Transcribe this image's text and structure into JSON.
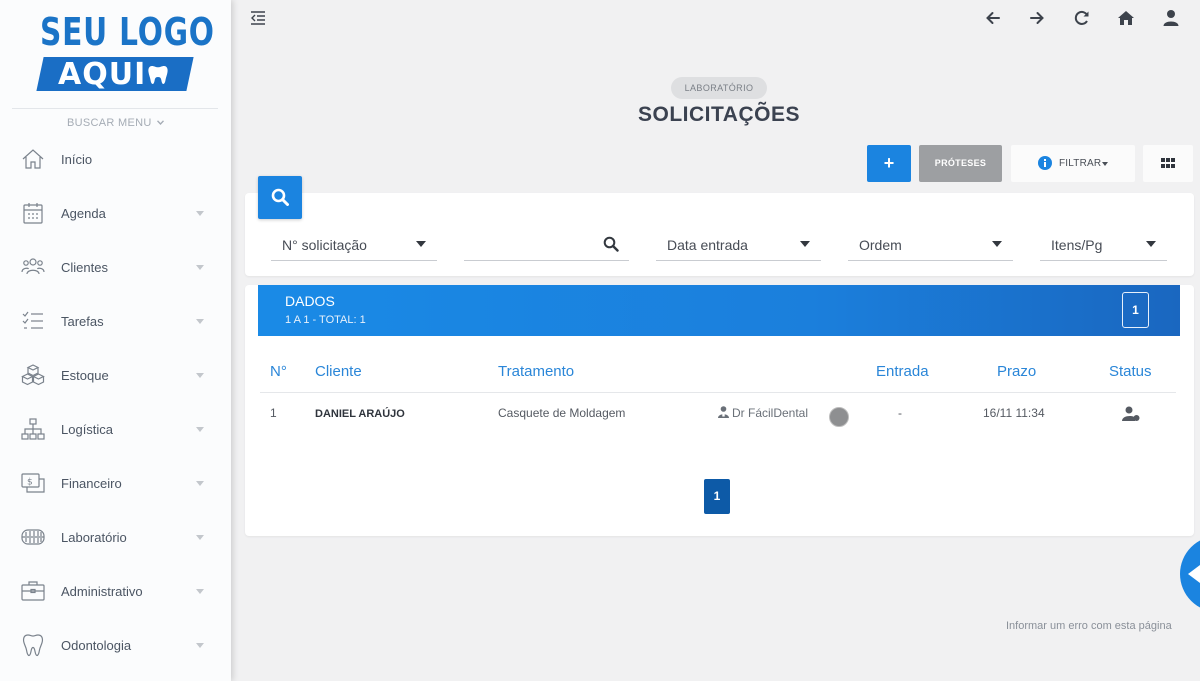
{
  "logo": {
    "line1": "SEU LOGO",
    "line2": "AQUI"
  },
  "sidebar": {
    "search_menu": "BUSCAR MENU",
    "items": [
      {
        "label": "Início",
        "icon": "home-icon",
        "has_caret": false
      },
      {
        "label": "Agenda",
        "icon": "calendar-icon",
        "has_caret": true
      },
      {
        "label": "Clientes",
        "icon": "users-icon",
        "has_caret": true
      },
      {
        "label": "Tarefas",
        "icon": "tasks-icon",
        "has_caret": true
      },
      {
        "label": "Estoque",
        "icon": "boxes-icon",
        "has_caret": true
      },
      {
        "label": "Logística",
        "icon": "hierarchy-icon",
        "has_caret": true
      },
      {
        "label": "Financeiro",
        "icon": "money-icon",
        "has_caret": true
      },
      {
        "label": "Laboratório",
        "icon": "dentures-icon",
        "has_caret": true
      },
      {
        "label": "Administrativo",
        "icon": "briefcase-icon",
        "has_caret": true
      },
      {
        "label": "Odontologia",
        "icon": "tooth-icon",
        "has_caret": true
      }
    ]
  },
  "header": {
    "breadcrumb": "LABORATÓRIO",
    "title": "SOLICITAÇÕES"
  },
  "toolbar": {
    "add_label": "+",
    "proteses_label": "PRÓTESES",
    "filter_label": "FILTRAR"
  },
  "filters": {
    "numero": "N° solicitação",
    "search_value": "",
    "data_entrada": "Data entrada",
    "ordem": "Ordem",
    "itens_pg": "Itens/Pg"
  },
  "data_panel": {
    "title": "DADOS",
    "subtitle": "1 A 1 - TOTAL: 1",
    "page_badge": "1"
  },
  "table": {
    "columns": [
      "N°",
      "Cliente",
      "Tratamento",
      "Entrada",
      "Prazo",
      "Status"
    ],
    "rows": [
      {
        "numero": "1",
        "cliente": "DANIEL ARAÚJO",
        "tratamento": "Casquete de Moldagem",
        "dentista": "Dr FácilDental",
        "entrada": "-",
        "prazo": "16/11 11:34"
      }
    ]
  },
  "pagination": {
    "current": "1"
  },
  "footer": {
    "report_link": "Informar um erro com esta página"
  },
  "colors": {
    "primary": "#1b84e0",
    "dark_primary": "#0d5aa7",
    "gray_button": "#9d9fa2",
    "logo_blue": "#1b74c7"
  }
}
